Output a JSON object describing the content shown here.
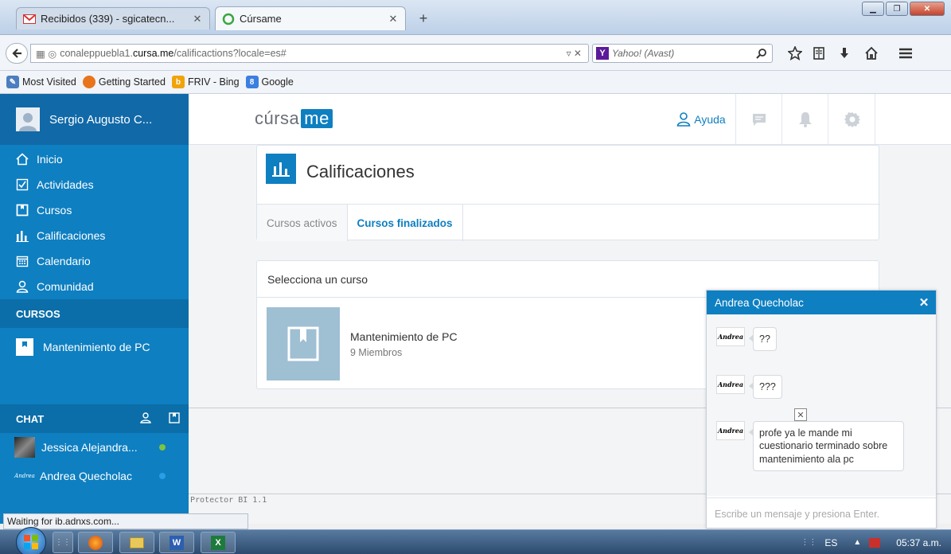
{
  "browser": {
    "tabs": [
      {
        "title": "Recibidos (339) - sgicatecn...",
        "icon": "gmail-icon"
      },
      {
        "title": "Cúrsame",
        "icon": "cursame-icon"
      }
    ],
    "url_prefix": "conaleppuebla1.",
    "url_domain": "cursa.me",
    "url_path": "/calificactions?locale=es#",
    "search_engine": "Yahoo! (Avast)",
    "bookmarks": [
      "Most Visited",
      "Getting Started",
      "FRIV - Bing",
      "Google"
    ],
    "status_text": "Waiting for ib.adnxs.com..."
  },
  "sidebar": {
    "user_name": "Sergio Augusto C...",
    "nav": [
      {
        "label": "Inicio",
        "icon": "home-icon"
      },
      {
        "label": "Actividades",
        "icon": "checkbox-icon"
      },
      {
        "label": "Cursos",
        "icon": "book-icon"
      },
      {
        "label": "Calificaciones",
        "icon": "bar-chart-icon"
      },
      {
        "label": "Calendario",
        "icon": "calendar-icon"
      },
      {
        "label": "Comunidad",
        "icon": "user-icon"
      }
    ],
    "courses_header": "CURSOS",
    "courses": [
      {
        "label": "Mantenimiento de PC"
      }
    ],
    "chat_header": "CHAT",
    "chat_contacts": [
      {
        "name": "Jessica Alejandra...",
        "status_color": "#7ec242"
      },
      {
        "name": "Andrea Quecholac",
        "status_color": "#2a9ee6"
      }
    ]
  },
  "topbar": {
    "logo_text": "cúrsa",
    "logo_badge": "me",
    "help_label": "Ayuda"
  },
  "page": {
    "title": "Calificaciones",
    "tabs": [
      "Cursos activos",
      "Cursos finalizados"
    ],
    "select_header": "Selecciona un curso",
    "course_name": "Mantenimiento de PC",
    "course_members": "9 Miembros",
    "footer_text": "Protector BI 1.1"
  },
  "chat_window": {
    "contact": "Andrea Quecholac",
    "messages": [
      {
        "text": "??"
      },
      {
        "text": "???"
      },
      {
        "text": "profe ya le mande mi cuestionario terminado sobre mantenimiento ala pc"
      }
    ],
    "avatar_text": "Andrea",
    "input_placeholder": "Escribe un mensaje y presiona Enter."
  },
  "taskbar": {
    "language": "ES",
    "clock": "05:37 a.m."
  },
  "colors": {
    "brand_blue": "#0e7fc1",
    "online": "#7ec242",
    "away": "#2a9ee6"
  }
}
